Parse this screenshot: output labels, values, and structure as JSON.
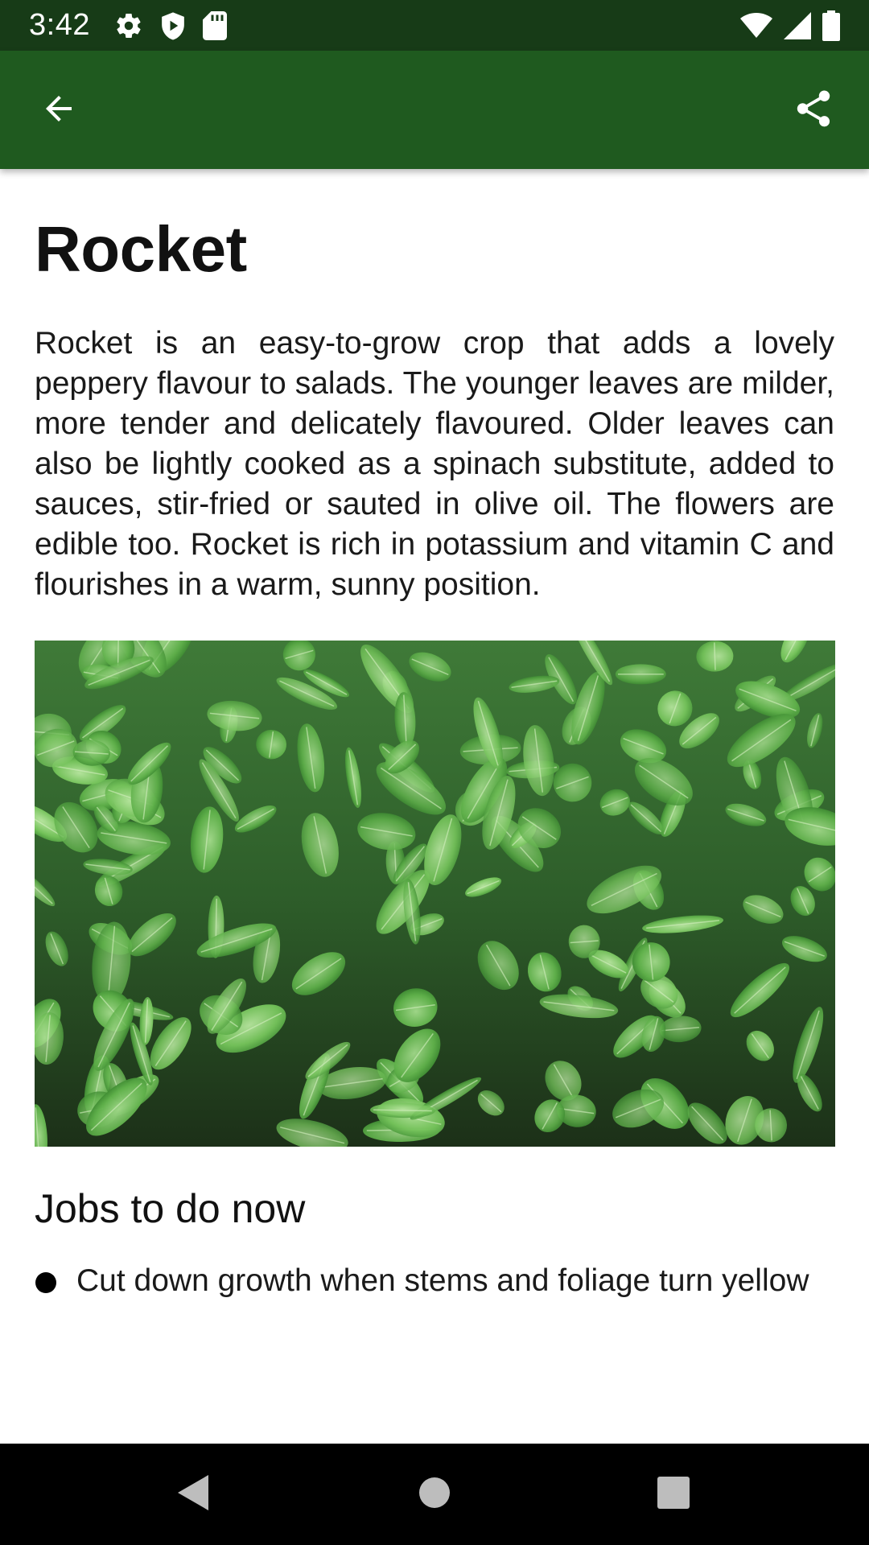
{
  "status_bar": {
    "time": "3:42",
    "left_icons": [
      "settings-gear-icon",
      "shield-play-icon",
      "sd-card-icon"
    ],
    "right_icons": [
      "wifi-icon",
      "cellular-signal-icon",
      "battery-icon"
    ]
  },
  "toolbar": {
    "back_icon": "arrow-back-icon",
    "share_icon": "share-icon",
    "background_color": "#1f5a1f"
  },
  "article": {
    "title": "Rocket",
    "description": "Rocket is an easy-to-grow crop that adds a lovely peppery flavour to salads. The younger leaves are milder, more tender and delicately flavoured. Older leaves can also be lightly cooked as a spinach substitute, added to sauces, stir-fried or sauted in olive oil. The flowers are edible too. Rocket is rich in potassium and vitamin C and flourishes in a warm, sunny position.",
    "image_subject": "rocket-leaves-photo",
    "jobs_heading": "Jobs to do now",
    "jobs": [
      "Cut down growth when stems and foliage turn yellow"
    ]
  },
  "nav_bar": {
    "buttons": [
      "nav-back-triangle-icon",
      "nav-home-circle-icon",
      "nav-recents-square-icon"
    ]
  },
  "colors": {
    "status_bar": "#173b17",
    "toolbar": "#1f5a1f",
    "text": "#1a1a1a"
  }
}
